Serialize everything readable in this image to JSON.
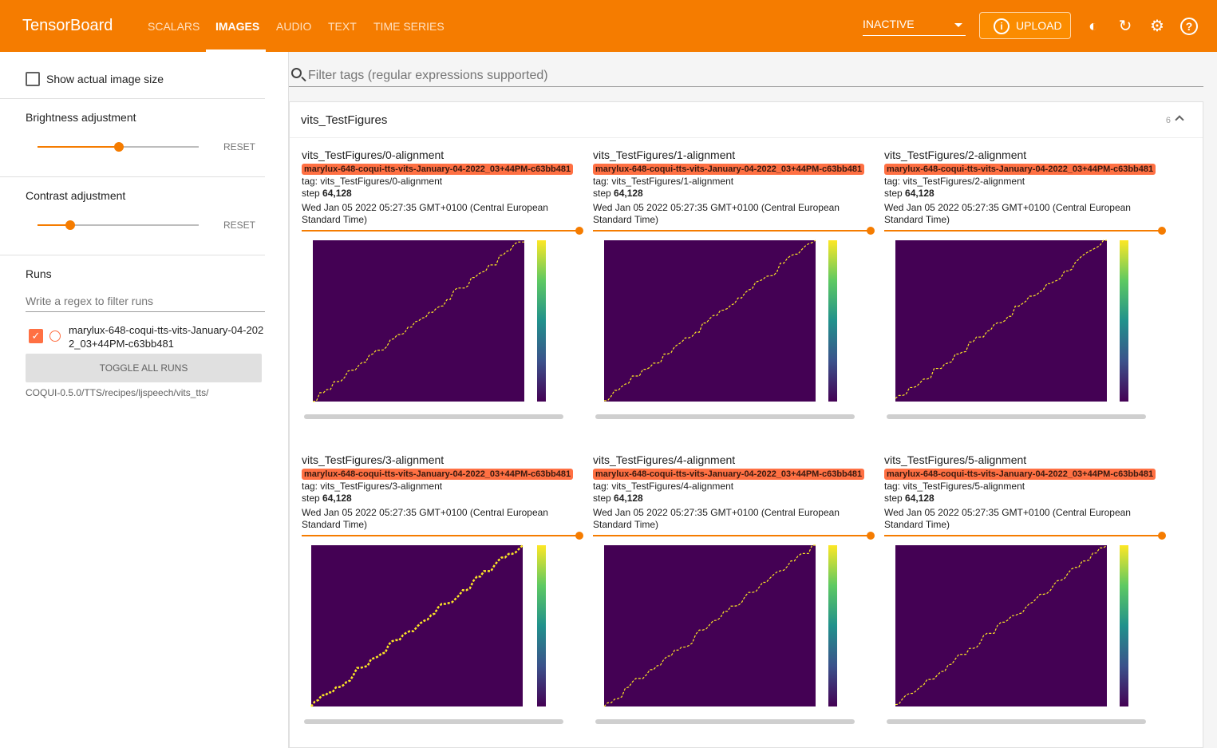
{
  "header": {
    "brand": "TensorBoard",
    "tabs": [
      "SCALARS",
      "IMAGES",
      "AUDIO",
      "TEXT",
      "TIME SERIES"
    ],
    "active_tab": "IMAGES",
    "run_selector": "INACTIVE",
    "upload": "UPLOAD"
  },
  "sidebar": {
    "show_actual_size": "Show actual image size",
    "brightness": {
      "label": "Brightness adjustment",
      "reset": "RESET",
      "value": 0.5
    },
    "contrast": {
      "label": "Contrast adjustment",
      "reset": "RESET",
      "value": 0.2
    },
    "runs": {
      "label": "Runs",
      "filter_placeholder": "Write a regex to filter runs",
      "run_name": "marylux-648-coqui-tts-vits-January-04-2022_03+44PM-c63bb481",
      "toggle_all": "TOGGLE ALL RUNS",
      "logdir": "COQUI-0.5.0/TTS/recipes/ljspeech/vits_tts/"
    }
  },
  "main": {
    "filter_placeholder": "Filter tags (regular expressions supported)",
    "group": {
      "name": "vits_TestFigures",
      "count": "6"
    },
    "figures": [
      {
        "title": "vits_TestFigures/0-alignment",
        "run": "marylux-648-coqui-tts-vits-January-04-2022_03+44PM-c63bb481",
        "tag": "tag: vits_TestFigures/0-alignment",
        "step_label": "step",
        "step": "64,128",
        "time": "Wed Jan 05 2022 05:27:35 GMT+0100 (Central European Standard Time)"
      },
      {
        "title": "vits_TestFigures/1-alignment",
        "run": "marylux-648-coqui-tts-vits-January-04-2022_03+44PM-c63bb481",
        "tag": "tag: vits_TestFigures/1-alignment",
        "step_label": "step",
        "step": "64,128",
        "time": "Wed Jan 05 2022 05:27:35 GMT+0100 (Central European Standard Time)"
      },
      {
        "title": "vits_TestFigures/2-alignment",
        "run": "marylux-648-coqui-tts-vits-January-04-2022_03+44PM-c63bb481",
        "tag": "tag: vits_TestFigures/2-alignment",
        "step_label": "step",
        "step": "64,128",
        "time": "Wed Jan 05 2022 05:27:35 GMT+0100 (Central European Standard Time)"
      },
      {
        "title": "vits_TestFigures/3-alignment",
        "run": "marylux-648-coqui-tts-vits-January-04-2022_03+44PM-c63bb481",
        "tag": "tag: vits_TestFigures/3-alignment",
        "step_label": "step",
        "step": "64,128",
        "time": "Wed Jan 05 2022 05:27:35 GMT+0100 (Central European Standard Time)"
      },
      {
        "title": "vits_TestFigures/4-alignment",
        "run": "marylux-648-coqui-tts-vits-January-04-2022_03+44PM-c63bb481",
        "tag": "tag: vits_TestFigures/4-alignment",
        "step_label": "step",
        "step": "64,128",
        "time": "Wed Jan 05 2022 05:27:35 GMT+0100 (Central European Standard Time)"
      },
      {
        "title": "vits_TestFigures/5-alignment",
        "run": "marylux-648-coqui-tts-vits-January-04-2022_03+44PM-c63bb481",
        "tag": "tag: vits_TestFigures/5-alignment",
        "step_label": "step",
        "step": "64,128",
        "time": "Wed Jan 05 2022 05:27:35 GMT+0100 (Central European Standard Time)"
      }
    ]
  },
  "colors": {
    "brand": "#f57c00",
    "run": "#ff7043",
    "plot_bg": "#440154",
    "alignment": "#fde725"
  }
}
